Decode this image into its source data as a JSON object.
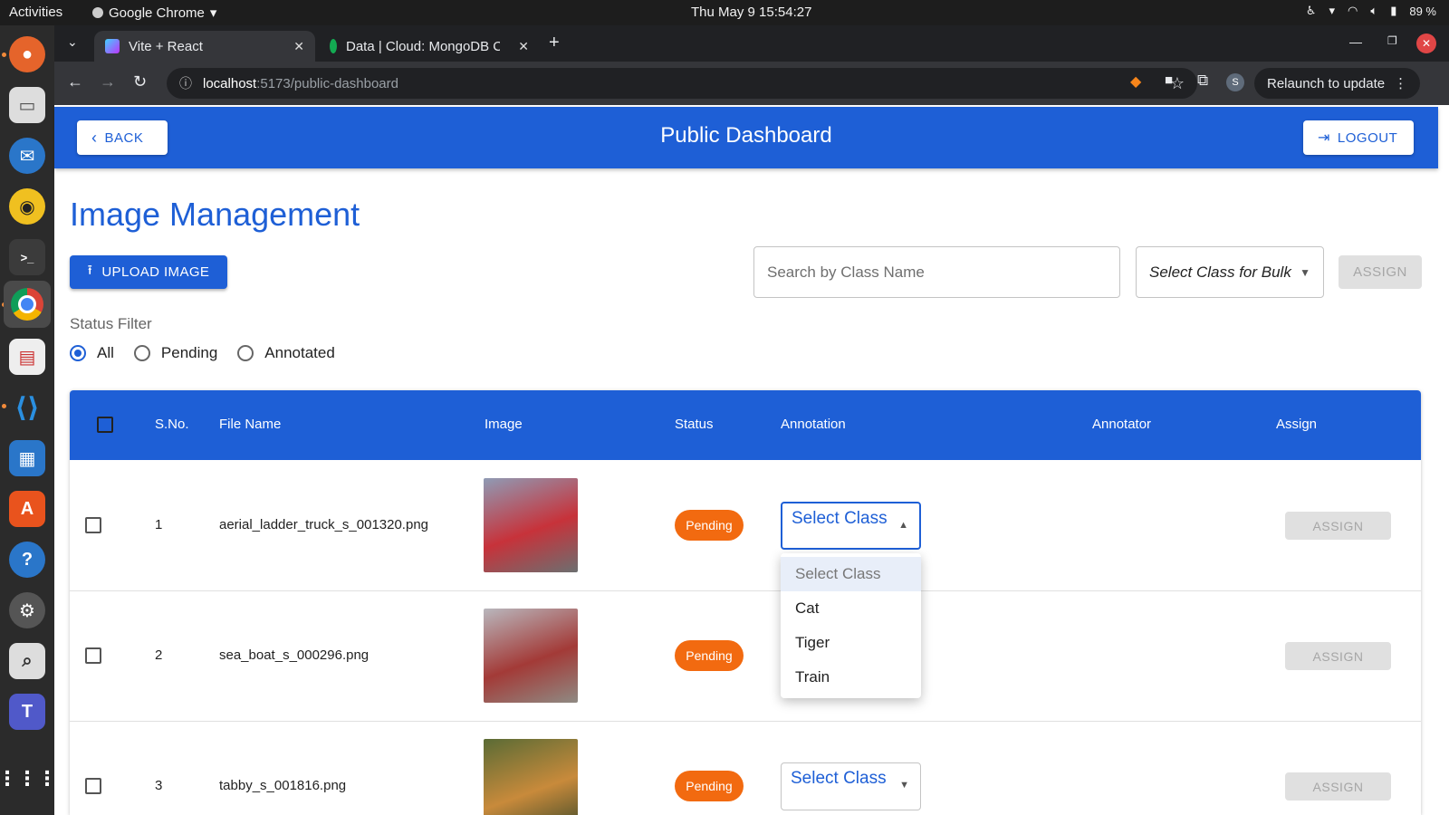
{
  "system": {
    "activities": "Activities",
    "app_name": "Google Chrome",
    "clock": "Thu May 9  15:54:27",
    "battery": "89 %"
  },
  "browser": {
    "tabs": [
      {
        "title": "Vite + React"
      },
      {
        "title": "Data | Cloud: MongoDB C"
      }
    ],
    "url_host": "localhost",
    "url_path": ":5173/public-dashboard",
    "relaunch_label": "Relaunch to update",
    "profile_initial": "S"
  },
  "header": {
    "back_label": "BACK",
    "title": "Public Dashboard",
    "logout_label": "LOGOUT"
  },
  "main": {
    "title": "Image Management",
    "upload_label": "UPLOAD IMAGE",
    "search_placeholder": "Search by Class Name",
    "bulk_select_label": "Select Class for Bulk",
    "bulk_assign_label": "ASSIGN",
    "status_filter_label": "Status Filter",
    "status_options": [
      "All",
      "Pending",
      "Annotated"
    ],
    "status_selected": "All"
  },
  "table": {
    "columns": [
      "S.No.",
      "File Name",
      "Image",
      "Status",
      "Annotation",
      "Annotator",
      "Assign"
    ],
    "rows": [
      {
        "sno": "1",
        "file": "aerial_ladder_truck_s_001320.png",
        "status": "Pending",
        "annotation": "Select Class",
        "annotator": "",
        "assign": "ASSIGN",
        "thumb_colors": [
          "#8f9bb5",
          "#c7323a",
          "#6c6f70"
        ]
      },
      {
        "sno": "2",
        "file": "sea_boat_s_000296.png",
        "status": "Pending",
        "annotation": "Select Class",
        "annotator": "",
        "assign": "ASSIGN",
        "thumb_colors": [
          "#b9b7bd",
          "#a33a37",
          "#8f8a83"
        ]
      },
      {
        "sno": "3",
        "file": "tabby_s_001816.png",
        "status": "Pending",
        "annotation": "Select Class",
        "annotator": "",
        "assign": "ASSIGN",
        "thumb_colors": [
          "#5a6b35",
          "#c88a3b",
          "#3f4a2a"
        ]
      }
    ]
  },
  "dropdown_menu": {
    "options": [
      "Select Class",
      "Cat",
      "Tiger",
      "Train"
    ],
    "highlighted": "Select Class"
  },
  "colors": {
    "primary": "#1e5fd6",
    "pending": "#f26a10"
  }
}
